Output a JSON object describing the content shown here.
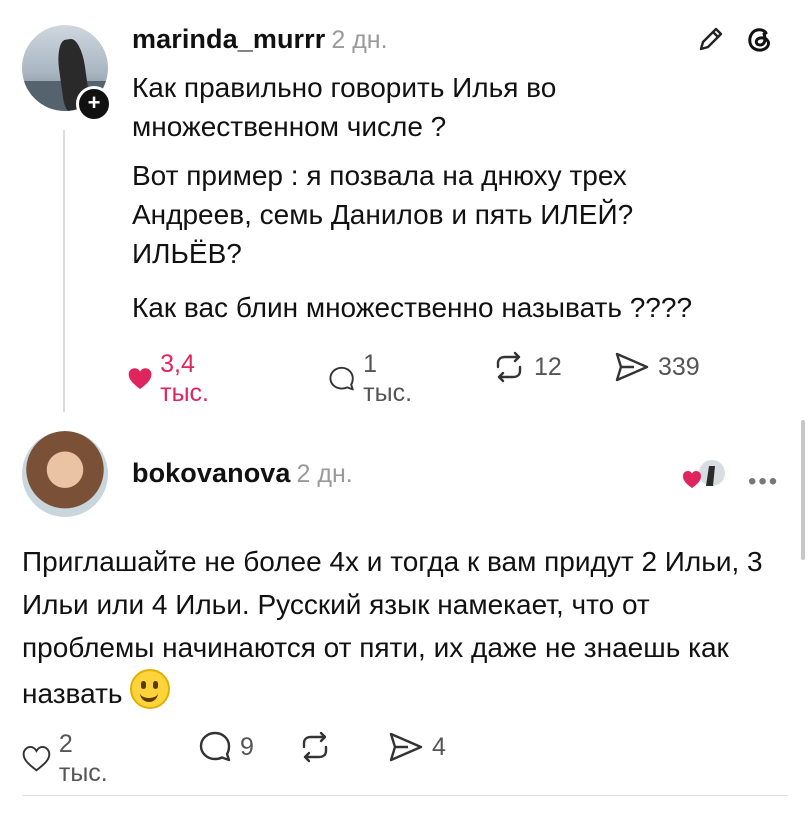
{
  "post": {
    "username": "marinda_murrr",
    "time": "2 дн.",
    "paragraphs": [
      "Как правильно говорить Илья во множественном числе ?",
      "Вот пример : я позвала на днюху трех Андреев, семь Данилов и пять ИЛЕЙ? ИЛЬЁВ?",
      "Как вас блин множественно называть ????"
    ],
    "stats": {
      "likes": "3,4 тыс.",
      "replies": "1 тыс.",
      "reposts": "12",
      "shares": "339"
    },
    "liked": true,
    "icons": [
      "edit-icon",
      "threads-logo-icon",
      "heart-icon",
      "reply-icon",
      "repost-icon",
      "share-icon",
      "follow-plus-icon"
    ]
  },
  "reply": {
    "username": "bokovanova",
    "time": "2 дн.",
    "text": "Приглашайте не более 4х и тогда к вам придут 2 Ильи, 3 Ильи или 4 Ильи. Русский язык намекает, что от проблемы начинаются от пяти, их даже не знаешь как назвать",
    "emoji": "grinning-face",
    "stats": {
      "likes": "2 тыс.",
      "replies": "9",
      "shares": "4"
    },
    "more_label": "•••"
  },
  "colors": {
    "accent_like": "#e0245e",
    "muted": "#9a9a9a",
    "text": "#111111"
  }
}
